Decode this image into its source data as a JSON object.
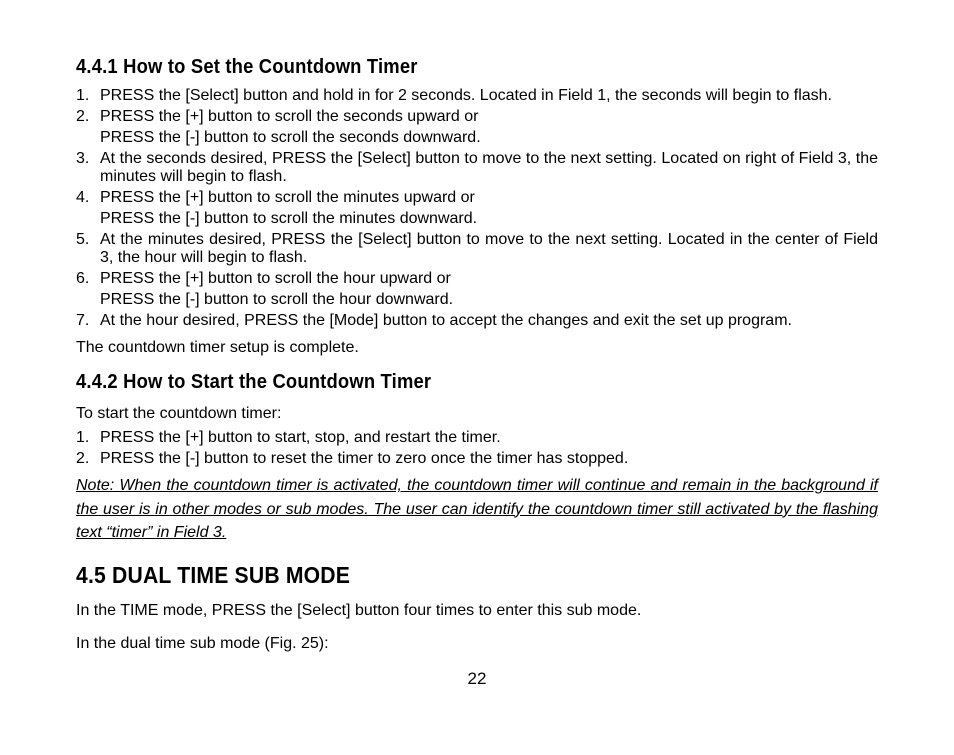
{
  "section441": {
    "heading": "4.4.1 How to Set the Countdown Timer",
    "steps": [
      {
        "num": "1.",
        "lines": [
          "PRESS the [Select] button and hold in for 2 seconds. Located in Field 1, the seconds will begin to flash."
        ]
      },
      {
        "num": "2.",
        "lines": [
          "PRESS the [+] button to scroll the seconds upward or",
          "PRESS the [-] button to scroll the seconds downward."
        ]
      },
      {
        "num": "3.",
        "lines": [
          "At the seconds desired, PRESS the [Select] button to move to the next setting. Located on right of Field 3, the minutes will begin to flash."
        ]
      },
      {
        "num": "4.",
        "lines": [
          "PRESS the [+] button to scroll the minutes upward or",
          "PRESS the [-] button to scroll the minutes downward."
        ]
      },
      {
        "num": "5.",
        "lines": [
          "At the minutes desired, PRESS the [Select] button to move to the next setting. Located in the center of Field 3, the hour will begin to flash."
        ]
      },
      {
        "num": "6.",
        "lines": [
          "PRESS the [+] button to scroll the hour upward or",
          "PRESS the [-] button to scroll the hour downward."
        ]
      },
      {
        "num": "7.",
        "lines": [
          "At the hour desired, PRESS the [Mode] button to accept the changes and exit the set up program."
        ]
      }
    ],
    "closing": "The countdown timer setup is complete."
  },
  "section442": {
    "heading": "4.4.2 How to Start the Countdown Timer",
    "intro": "To start the countdown timer:",
    "steps": [
      {
        "num": "1.",
        "lines": [
          "PRESS the [+] button to start, stop, and restart the timer."
        ]
      },
      {
        "num": "2.",
        "lines": [
          "PRESS the [-] button to reset the timer to zero once the timer has stopped."
        ]
      }
    ],
    "note": "Note: When the countdown timer is activated, the countdown timer will continue and remain in the background if the user is in other modes or sub modes. The user can identify the countdown timer still activated by the flashing text “timer” in Field 3."
  },
  "section45": {
    "heading": "4.5 DUAL TIME SUB MODE",
    "p1": "In the TIME mode, PRESS the [Select] button four times to enter this sub mode.",
    "p2": "In the dual time sub mode (Fig. 25):"
  },
  "pagenum": "22"
}
